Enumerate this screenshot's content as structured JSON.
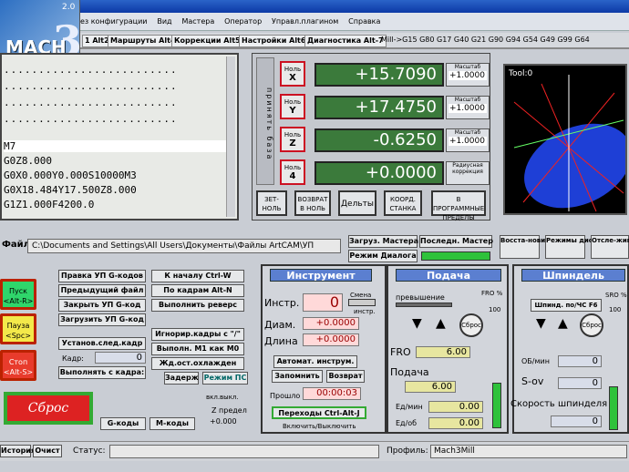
{
  "app": {
    "version": "2.0",
    "logo_text": "MACH",
    "logo_num": "3"
  },
  "menu": [
    "Вид",
    "Мастера",
    "Оператор",
    "Управл.плагином",
    "Справка"
  ],
  "menu_cut": "ез конфигурации",
  "tabs": [
    "1 Alt2",
    "Маршруты Alt4",
    "Коррекции Alt5",
    "Настройки Alt6",
    "Диагностика Alt-7"
  ],
  "gcodes": "Mill->G15  G80 G17 G40 G21 G90 G94 G54 G49 G99 G64",
  "gcode_lines": [
    "M7",
    "G0Z8.000",
    "G0X0.000Y0.000S10000M3",
    "G0X18.484Y17.500Z8.000",
    "G1Z1.000F4200.0"
  ],
  "dro": {
    "side_label": "принять база",
    "axes": [
      {
        "btn": "Ноль",
        "axis": "X",
        "value": "+15.7090",
        "scale_label": "Масштаб",
        "scale": "+1.0000"
      },
      {
        "btn": "Ноль",
        "axis": "Y",
        "value": "+17.4750",
        "scale_label": "Масштаб",
        "scale": "+1.0000"
      },
      {
        "btn": "Ноль",
        "axis": "Z",
        "value": "-0.6250",
        "scale_label": "Масштаб",
        "scale": "+1.0000"
      },
      {
        "btn": "Ноль",
        "axis": "4",
        "value": "+0.0000",
        "scale_label": "Радиусная коррекция",
        "scale": ""
      }
    ],
    "buttons": [
      "ЗЕТ-НОЛЬ",
      "ВОЗВРАТ В НОЛЬ",
      "Дельты",
      "КООРД. СТАНКА",
      "В ПРОГРАММНЫЕ ПРЕДЕЛЫ"
    ]
  },
  "toolpath": {
    "title": "Tool:0"
  },
  "file": {
    "label": "Файл:",
    "path": "C:\\Documents and Settings\\All Users\\Документы\\Файлы АrtCAM\\УП"
  },
  "load_buttons": [
    "Загруз. Мастера",
    "Последн. Мастер",
    "Режим Диалога"
  ],
  "right_buttons": [
    "Восста-новить",
    "Режимы дисплея",
    "Отсле-живан"
  ],
  "left_side": [
    {
      "label": "Пуск",
      "key": "<Alt-R>"
    },
    {
      "label": "Пауза",
      "key": "<Spc>"
    },
    {
      "label": "Стоп",
      "key": "<Alt-S>"
    }
  ],
  "program_buttons": [
    "Правка УП G-кодов",
    "Предыдущий файл",
    "Закрыть УП G-код",
    "Загрузить УП G-код",
    "Установ.след.кадр",
    "Кадр:",
    "Выполнять с кадра:"
  ],
  "line_value": "0",
  "program_buttons2": [
    "К началу Ctrl-W",
    "По кадрам Alt-N",
    "Выполнить реверс",
    "Игнорир.кадры с \"/\"",
    "Выполн. М1 как М0",
    "Жд.ост.охлажден"
  ],
  "mode_buttons": [
    "Задерж",
    "Режим ПС"
  ],
  "reset_label": "Сброс",
  "gcode_buttons": [
    "G-коды",
    "М-коды"
  ],
  "limits": [
    "вкл.выкл.",
    "Z предел",
    "+0.000"
  ],
  "tool": {
    "title": "Инструмент",
    "labels": [
      "Инстр.",
      "Диам.",
      "Длина"
    ],
    "values": [
      "0",
      "+0.0000",
      "+0.0000"
    ],
    "small": [
      "Смена",
      "инстр."
    ],
    "buttons": [
      "Автомат. инструм.",
      "Запомнить",
      "Возврат",
      "Переходы Ctrl-Alt-J"
    ],
    "elapsed_label": "Прошло",
    "elapsed": "00:00:03",
    "on_off": "Включить/Выключить"
  },
  "feed": {
    "title": "Подача",
    "over_label": "превышение",
    "fro_pct_label": "FRO %",
    "fro_pct": "100",
    "reset": "Сброс",
    "fro_label": "FRO",
    "fro": "6.00",
    "feed_label": "Подача",
    "feed": "6.00",
    "units": [
      {
        "label": "Ед/мин",
        "value": "0.00"
      },
      {
        "label": "Ед/об",
        "value": "0.00"
      }
    ]
  },
  "spindle": {
    "title": "Шпиндель",
    "btn": "Шпинд. по/ЧС F6",
    "sro_label": "SRO %",
    "sro": "100",
    "reset": "Сброс",
    "rpm_label": "ОБ/мин",
    "rpm": "0",
    "sov_label": "S-ov",
    "sov": "0",
    "speed_label": "Скорость шпинделя",
    "speed": "0"
  },
  "status": {
    "history": "История",
    "clear": "Очист",
    "status_label": "Статус:",
    "profile_label": "Профиль:",
    "profile": "Mach3Mill"
  },
  "colors": {
    "lcd": "#3b7a3b",
    "section": "#5b7fd0",
    "danger": "#d22"
  }
}
